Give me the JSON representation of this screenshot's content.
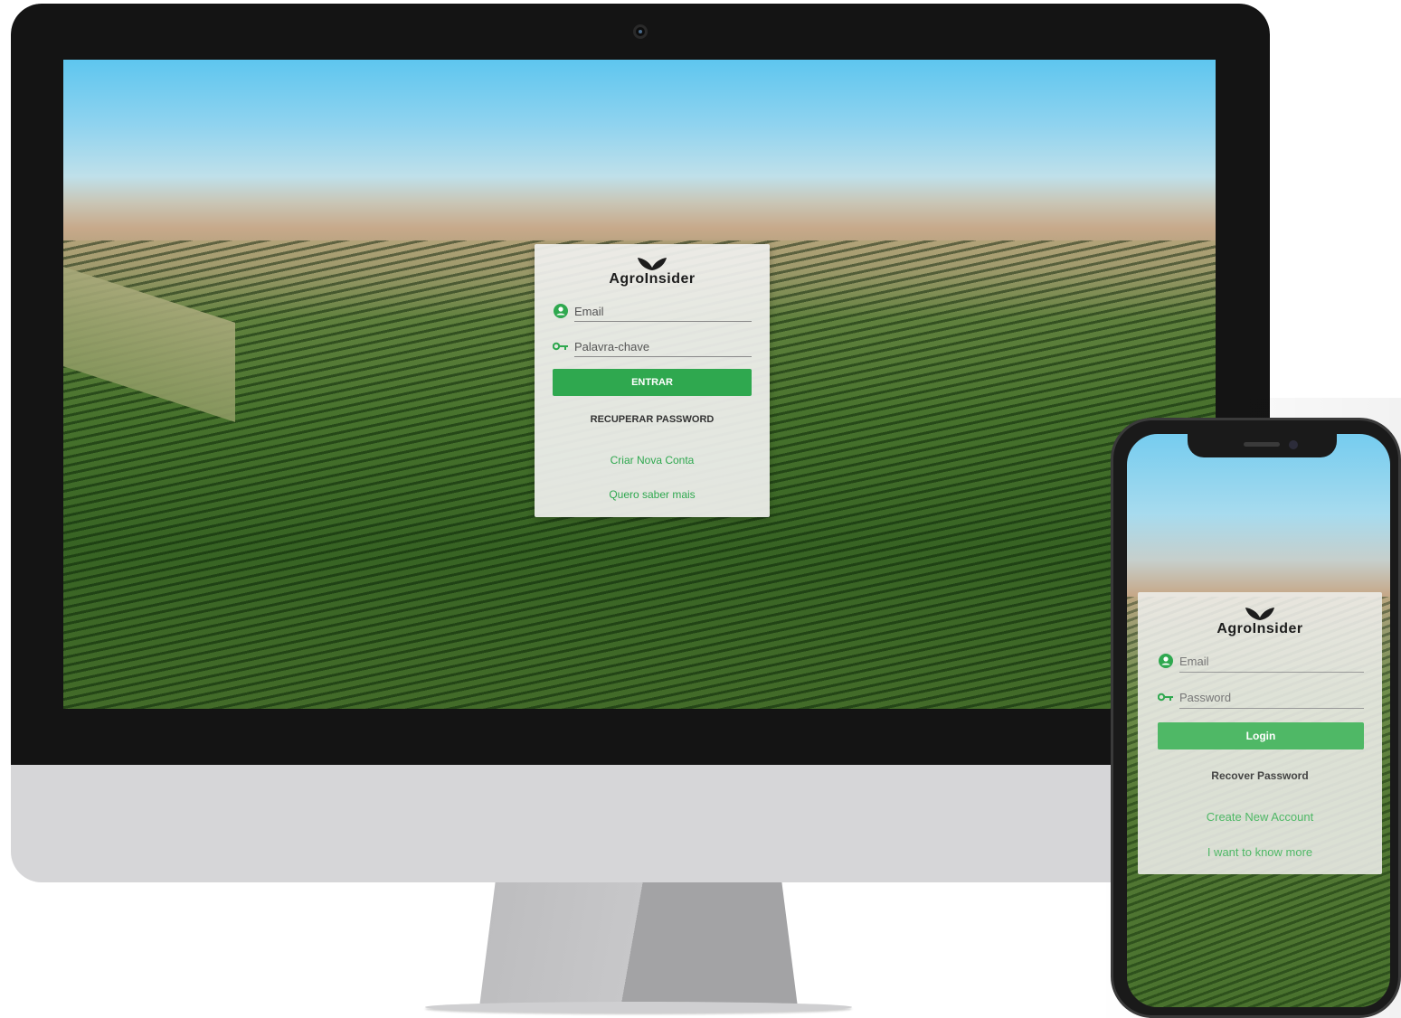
{
  "desktop": {
    "brand": "AgroInsider",
    "email_placeholder": "Email",
    "password_placeholder": "Palavra-chave",
    "login_button": "ENTRAR",
    "recover_link": "RECUPERAR PASSWORD",
    "create_account_link": "Criar Nova Conta",
    "know_more_link": "Quero saber mais"
  },
  "mobile": {
    "brand": "AgroInsider",
    "email_placeholder": "Email",
    "password_placeholder": "Password",
    "login_button": "Login",
    "recover_link": "Recover Password",
    "create_account_link": "Create New Account",
    "know_more_link": "I want to know more"
  },
  "colors": {
    "accent_green": "#2fa84f",
    "icon_green": "#2fa84f"
  },
  "icons": [
    "user-icon",
    "key-icon",
    "leaf-logo-icon"
  ]
}
